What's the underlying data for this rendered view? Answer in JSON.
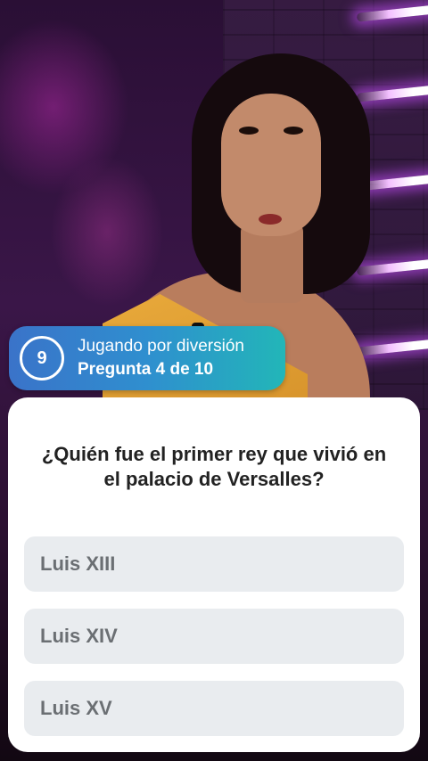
{
  "status": {
    "timer_value": "9",
    "mode_text": "Jugando por diversión",
    "progress_text": "Pregunta 4 de 10"
  },
  "question": {
    "text": "¿Quién fue el primer rey que vivió en el palacio de Versalles?"
  },
  "answers": [
    {
      "label": "Luis XIII"
    },
    {
      "label": "Luis XIV"
    },
    {
      "label": "Luis XV"
    }
  ]
}
